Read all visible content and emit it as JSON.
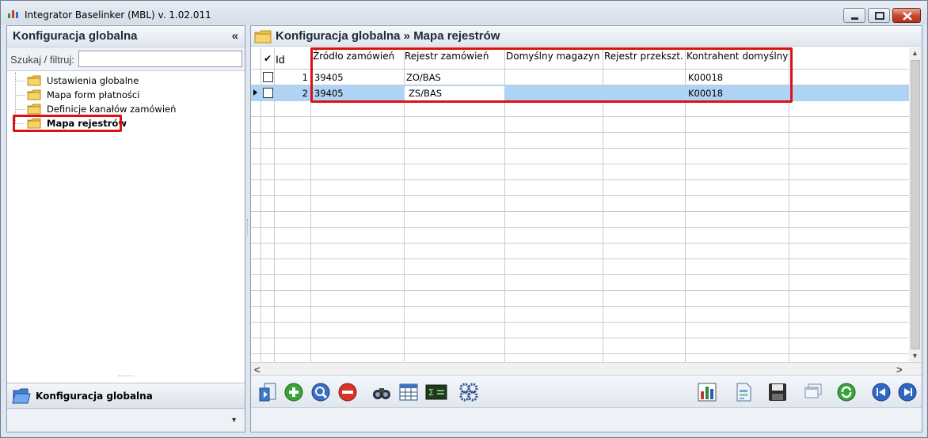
{
  "window": {
    "title": "Integrator Baselinker (MBL) v. 1.02.011"
  },
  "left_panel": {
    "title": "Konfiguracja globalna",
    "collapse_glyph": "«",
    "search_label": "Szukaj / filtruj:",
    "search_value": "",
    "tree": [
      {
        "label": "Ustawienia globalne",
        "icon": "folder-icon",
        "selected": false
      },
      {
        "label": "Mapa form płatności",
        "icon": "folder-icon",
        "selected": false
      },
      {
        "label": "Definicje kanałów zamówień",
        "icon": "folder-icon",
        "selected": false
      },
      {
        "label": "Mapa rejestrów",
        "icon": "folder-icon",
        "selected": true
      }
    ],
    "nav_item": {
      "label": "Konfiguracja globalna",
      "icon": "folder-open-icon"
    }
  },
  "right_panel": {
    "breadcrumb": "Konfiguracja globalna » Mapa rejestrów",
    "grid": {
      "check_header": "✔",
      "columns": [
        "Id",
        "Źródło zamówień",
        "Rejestr zamówień",
        "Domyślny magazyn",
        "Rejestr przekszt.",
        "Kontrahent domyślny"
      ],
      "rows": [
        {
          "id": "1",
          "source": "39405",
          "register": "ZO/BAS",
          "warehouse": "",
          "conv_register": "",
          "contractor": "K00018",
          "selected": false
        },
        {
          "id": "2",
          "source": "39405",
          "register": "ZS/BAS",
          "warehouse": "",
          "conv_register": "",
          "contractor": "K00018",
          "selected": true
        }
      ]
    },
    "toolbar": {
      "left": [
        "import-icon",
        "add-icon",
        "edit-icon",
        "delete-icon",
        "find-icon",
        "filter-grid-icon",
        "calculator-icon",
        "settings-gears-icon"
      ],
      "right": [
        "report-chart-icon",
        "document-icon",
        "save-icon",
        "windows-icon",
        "refresh-icon",
        "first-record-icon",
        "next-record-icon"
      ]
    }
  },
  "colors": {
    "highlight_red": "#d11111",
    "selected_row": "#aed3f4",
    "panel_border": "#8f9db1"
  }
}
